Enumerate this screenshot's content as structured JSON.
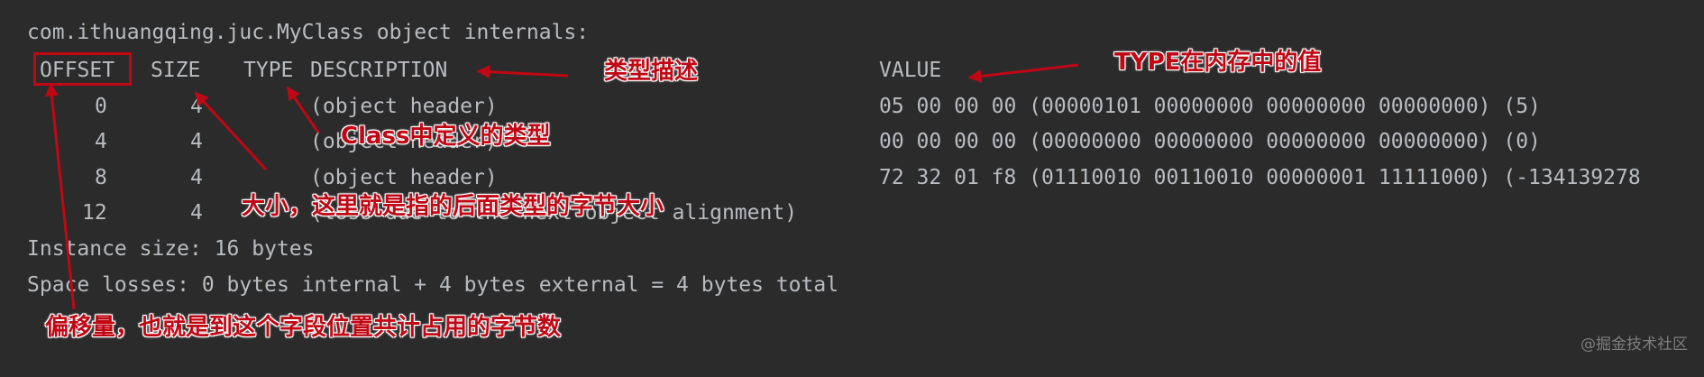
{
  "output": {
    "title": "com.ithuangqing.juc.MyClass object internals:",
    "columns": {
      "offset": "OFFSET",
      "size": "SIZE",
      "type": "TYPE",
      "description": "DESCRIPTION",
      "value": "VALUE"
    },
    "rows": [
      {
        "offset": "0",
        "size": "4",
        "type": "",
        "description": "(object header)",
        "value": "05 00 00 00 (00000101 00000000 00000000 00000000) (5)"
      },
      {
        "offset": "4",
        "size": "4",
        "type": "",
        "description": "(object header)",
        "value": "00 00 00 00 (00000000 00000000 00000000 00000000) (0)"
      },
      {
        "offset": "8",
        "size": "4",
        "type": "",
        "description": "(object header)",
        "value": "72 32 01 f8 (01110010 00110010 00000001 11111000) (-134139278"
      },
      {
        "offset": "12",
        "size": "4",
        "type": "",
        "description": "(loss due to the next object alignment)",
        "value": ""
      }
    ],
    "instance_size": "Instance size: 16 bytes",
    "space_losses": "Space losses: 0 bytes internal + 4 bytes external = 4 bytes total"
  },
  "annotations": {
    "type_description": "类型描述",
    "value_in_memory": "TYPE在内存中的值",
    "class_type": "Class中定义的类型",
    "size_note": "大小，这里就是指的后面类型的字节大小",
    "offset_note": "偏移量，也就是到这个字段位置共计占用的字节数"
  },
  "watermark": "@掘金技术社区",
  "colors": {
    "background": "#2b2b2b",
    "text": "#b9bcc0",
    "annotation": "#c00815"
  }
}
